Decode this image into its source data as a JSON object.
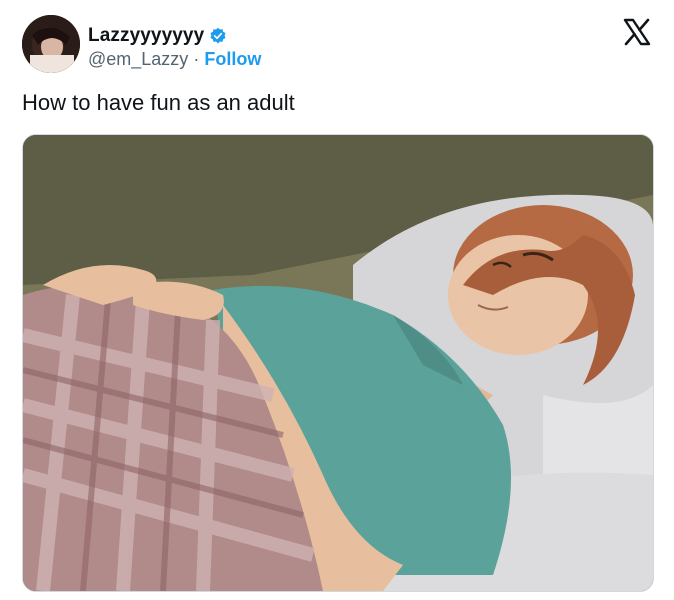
{
  "tweet": {
    "display_name": "Lazzyyyyyyy",
    "handle": "@em_Lazzy",
    "separator": "·",
    "follow_label": "Follow",
    "text": "How to have fun as an adult"
  },
  "icons": {
    "verified": "verified-badge-icon",
    "platform": "x-logo-icon"
  },
  "colors": {
    "accent": "#1d9bf0",
    "text": "#0f1419",
    "muted": "#536471"
  }
}
